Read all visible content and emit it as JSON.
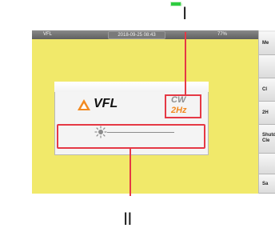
{
  "status": {
    "device": "VFL",
    "datetime": "2018-09-25 08:43",
    "battery": "77%"
  },
  "panel": {
    "title": "VFL",
    "mode": {
      "wave": "CW",
      "freq": "2Hz"
    }
  },
  "sidebar": {
    "items": [
      "Me",
      "",
      "Cl",
      "2H",
      "Shutd Cle",
      "",
      "Sa"
    ]
  },
  "callouts": {
    "first": "I",
    "second": "II"
  },
  "colors": {
    "screen": "#f1e96a",
    "highlight": "#e53945",
    "accent_orange": "#f28a21"
  }
}
